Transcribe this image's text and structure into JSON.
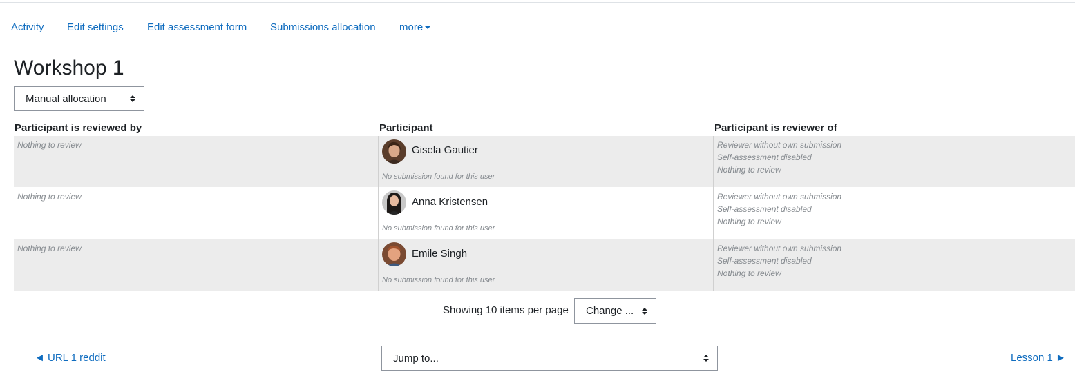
{
  "secondary_nav": {
    "items": [
      {
        "label": "Activity"
      },
      {
        "label": "Edit settings"
      },
      {
        "label": "Edit assessment form"
      },
      {
        "label": "Submissions allocation"
      }
    ],
    "more_label": "more"
  },
  "page": {
    "title": "Workshop 1"
  },
  "allocation_select": {
    "selected": "Manual allocation"
  },
  "table": {
    "headers": {
      "reviewed_by": "Participant is reviewed by",
      "participant": "Participant",
      "reviewer_of": "Participant is reviewer of"
    },
    "rows": [
      {
        "reviewed_by": "Nothing to review",
        "participant": "Gisela Gautier",
        "submission_note": "No submission found for this user",
        "reviewer_of": [
          "Reviewer without own submission",
          "Self-assessment disabled",
          "Nothing to review"
        ]
      },
      {
        "reviewed_by": "Nothing to review",
        "participant": "Anna Kristensen",
        "submission_note": "No submission found for this user",
        "reviewer_of": [
          "Reviewer without own submission",
          "Self-assessment disabled",
          "Nothing to review"
        ]
      },
      {
        "reviewed_by": "Nothing to review",
        "participant": "Emile Singh",
        "submission_note": "No submission found for this user",
        "reviewer_of": [
          "Reviewer without own submission",
          "Self-assessment disabled",
          "Nothing to review"
        ]
      }
    ]
  },
  "pagination": {
    "per_page_label": "Showing 10 items per page",
    "change_select": "Change ..."
  },
  "activity_nav": {
    "prev_link": "◄ URL 1 reddit",
    "jump_select": "Jump to...",
    "next_link": "Lesson 1 ►"
  },
  "colors": {
    "link": "#0f6cbf",
    "row_shade": "#ececec",
    "muted_text": "#858a8f"
  }
}
